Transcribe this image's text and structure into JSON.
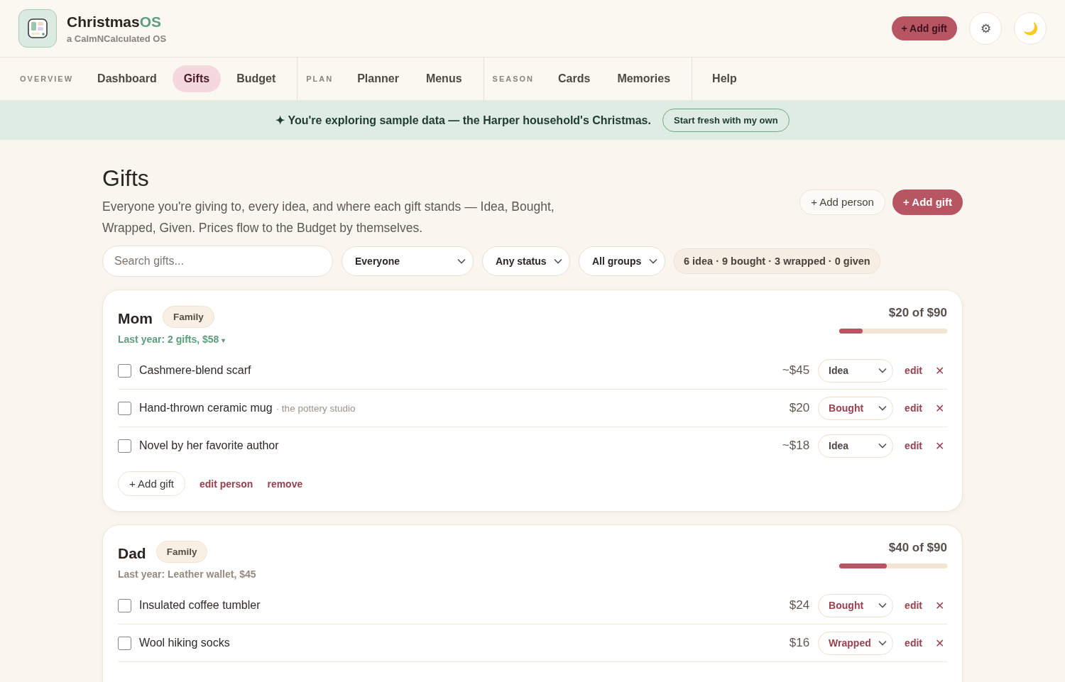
{
  "brand": {
    "name": "Christmas",
    "name_accent": "OS",
    "tagline": "a CalmNCalculated OS"
  },
  "header_actions": {
    "add_button": "+ Add gift",
    "settings_glyph": "⚙",
    "theme_glyph": "🌙"
  },
  "nav": [
    {
      "label": "OVERVIEW",
      "items": [
        {
          "label": "Dashboard",
          "selected": false
        },
        {
          "label": "Gifts",
          "selected": true
        },
        {
          "label": "Budget",
          "selected": false
        }
      ]
    },
    {
      "label": "PLAN",
      "items": [
        {
          "label": "Planner",
          "selected": false
        },
        {
          "label": "Menus",
          "selected": false
        }
      ]
    },
    {
      "label": "SEASON",
      "items": [
        {
          "label": "Cards",
          "selected": false
        },
        {
          "label": "Memories",
          "selected": false
        }
      ]
    },
    {
      "items": [
        {
          "label": "Help",
          "selected": false
        }
      ]
    }
  ],
  "banner": {
    "text": "✦ You're exploring sample data — the Harper household's Christmas.",
    "button": "Start fresh with my own"
  },
  "page": {
    "title": "Gifts",
    "description": "Everyone you're giving to, every idea, and where each gift stands — Idea, Bought, Wrapped, Given. Prices flow to the Budget by themselves.",
    "add_person": "+ Add person",
    "add_gift": "+ Add gift"
  },
  "filters": {
    "search_placeholder": "Search gifts...",
    "selects": [
      "Everyone",
      "Any status",
      "All groups"
    ],
    "summary": "6 idea · 9 bought · 3 wrapped · 0 given"
  },
  "people": [
    {
      "name": "Mom",
      "group": "Family",
      "last_year": "Last year: 2 gifts, $58",
      "last_year_caret": "▾",
      "spent": "$20 of $90",
      "level": 0.22,
      "gifts": [
        {
          "name": "Cashmere-blend scarf",
          "checked": false,
          "price": "~$45",
          "status": "Idea",
          "emphasis": false,
          "edit": "edit",
          "delete": "✕"
        },
        {
          "name": "Hand-thrown ceramic mug",
          "source": "· the pottery studio",
          "checked": false,
          "price": "$20",
          "status": "Bought",
          "emphasis": true,
          "edit": "edit",
          "delete": "✕"
        },
        {
          "name": "Novel by her favorite author",
          "checked": false,
          "price": "~$18",
          "status": "Idea",
          "emphasis": false,
          "edit": "edit",
          "delete": "✕"
        }
      ],
      "footer": {
        "add": "+ Add gift",
        "edit": "edit person",
        "remove": "remove"
      }
    },
    {
      "name": "Dad",
      "group": "Family",
      "last_year": "Last year: Leather wallet, $45",
      "spent": "$40 of $90",
      "level": 0.44,
      "gifts": [
        {
          "name": "Insulated coffee tumbler",
          "checked": false,
          "price": "$24",
          "status": "Bought",
          "emphasis": true,
          "edit": "edit",
          "delete": "✕"
        },
        {
          "name": "Wool hiking socks",
          "checked": false,
          "price": "$16",
          "status": "Wrapped",
          "emphasis": true,
          "edit": "edit",
          "delete": "✕"
        }
      ]
    }
  ]
}
